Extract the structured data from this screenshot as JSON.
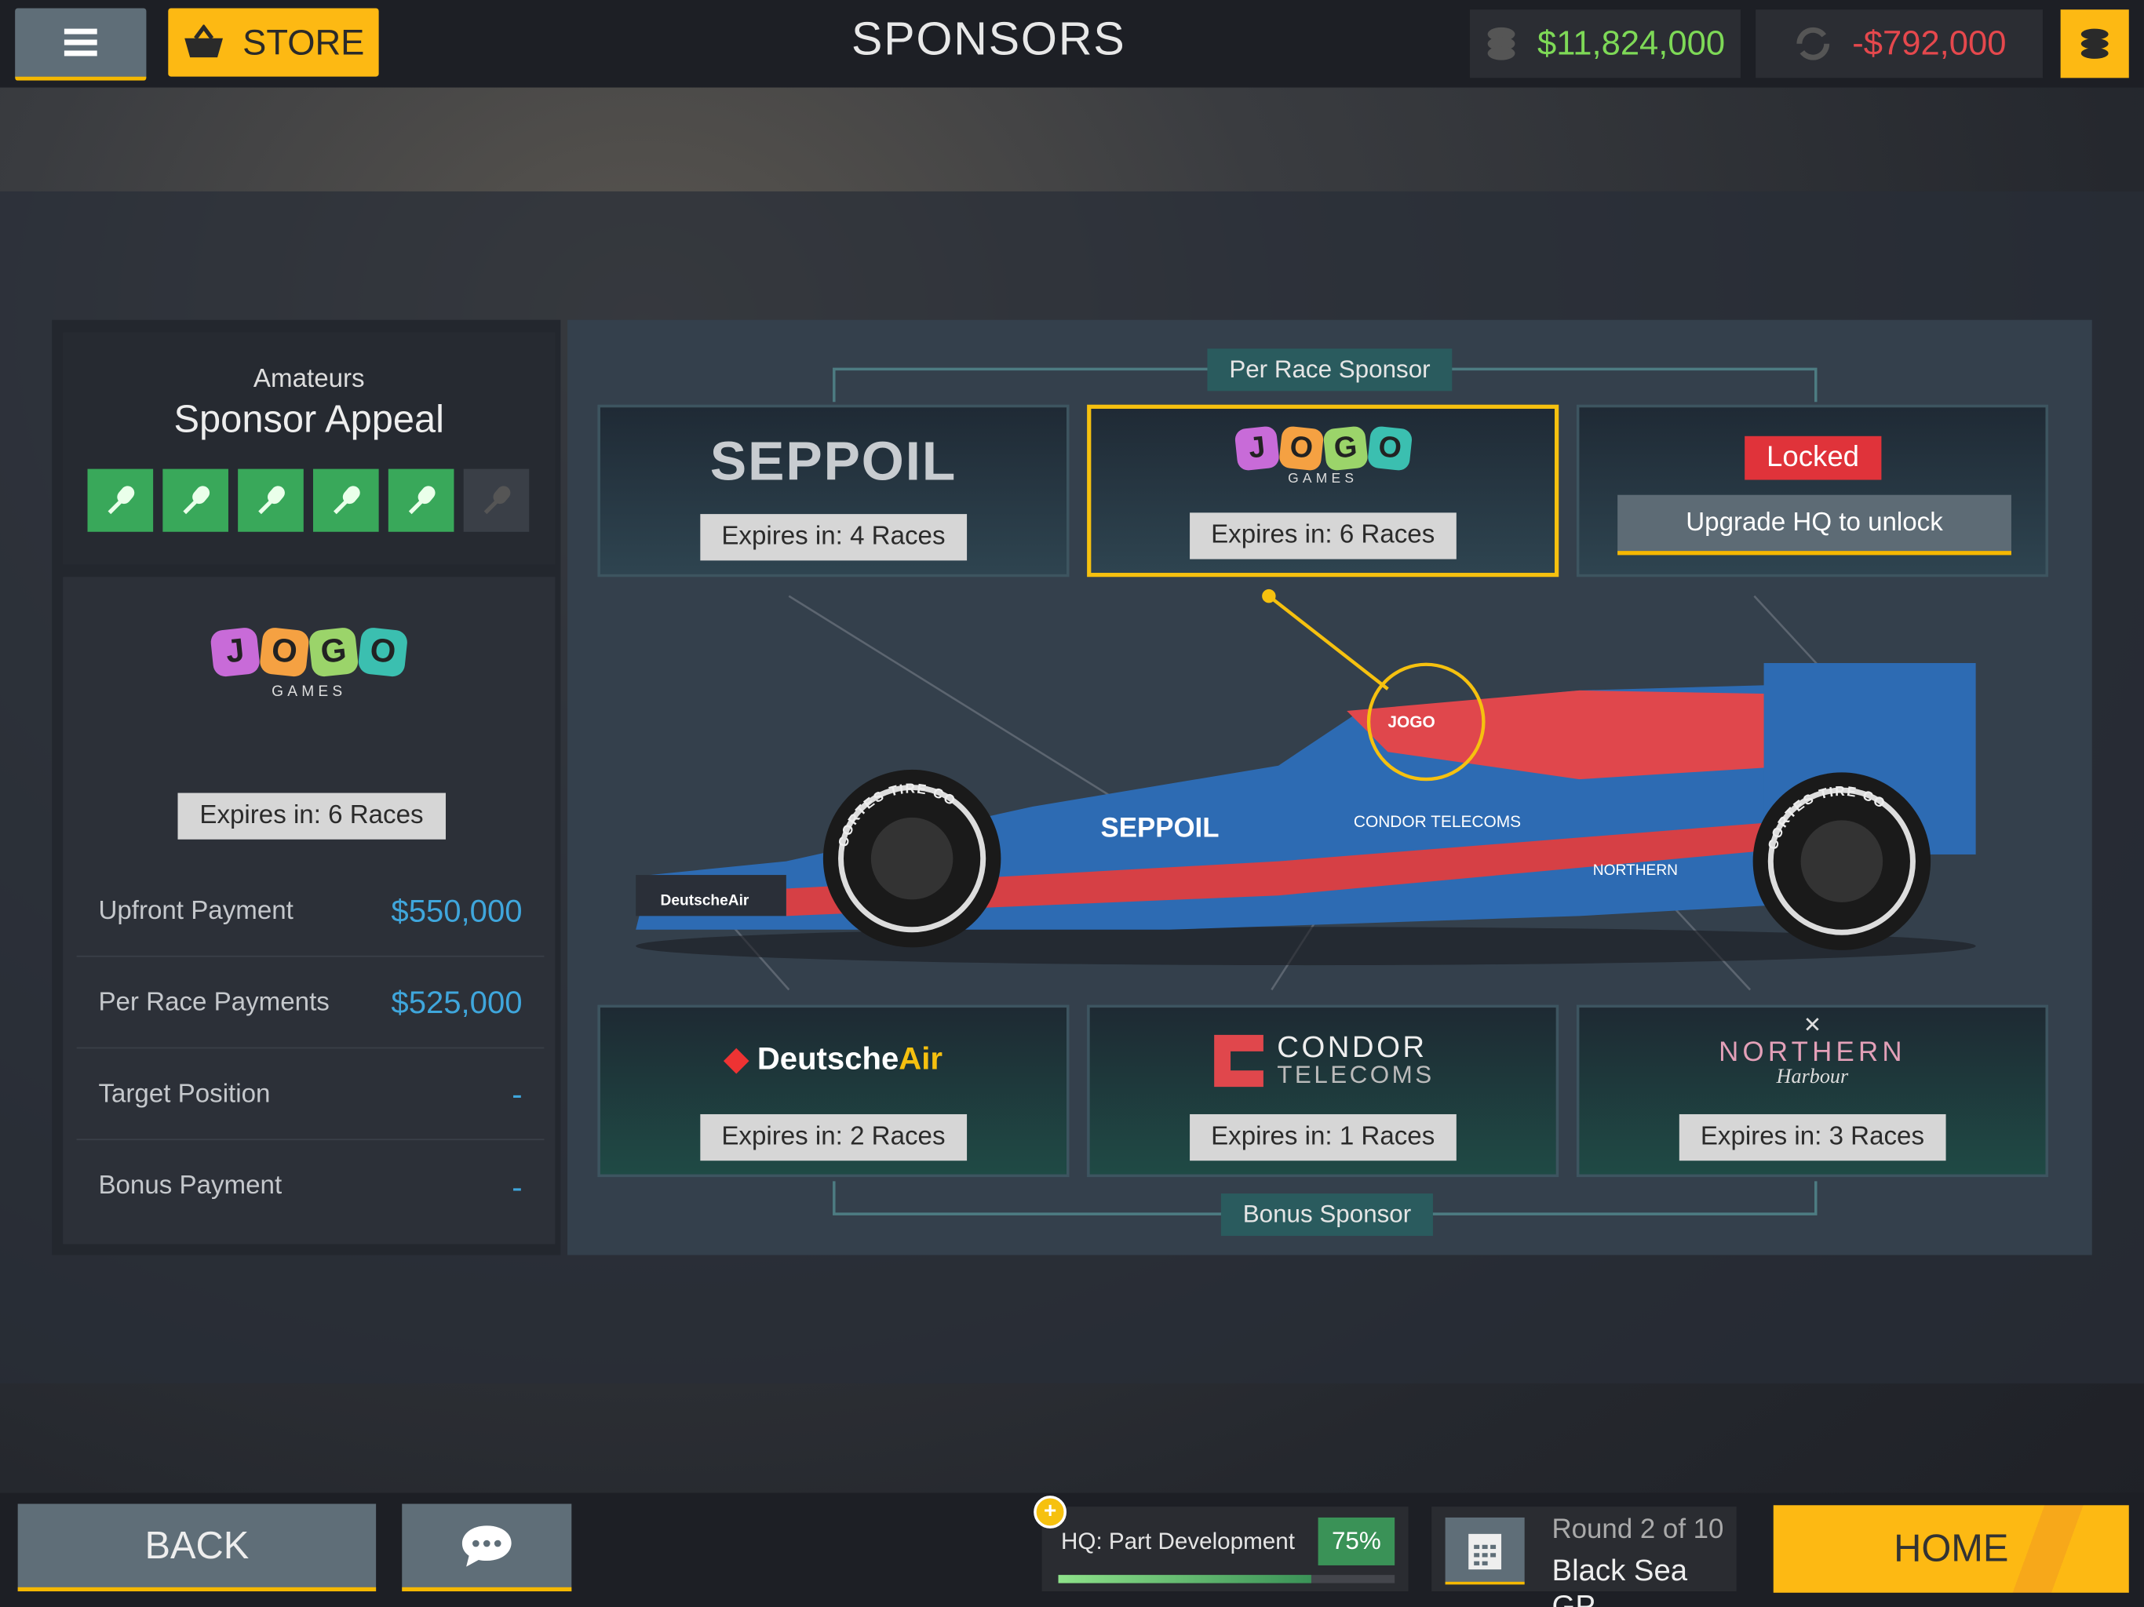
{
  "header": {
    "title": "SPONSORS",
    "store_label": "STORE",
    "balance": "$11,824,000",
    "balance_color": "#7ed957",
    "net_change": "-$792,000",
    "net_change_color": "#e5484d",
    "accent": "#fdb913"
  },
  "appeal": {
    "tier": "Amateurs",
    "title": "Sponsor Appeal",
    "level": 5,
    "max": 6
  },
  "selected": {
    "logo": "JOGO",
    "logo_sub": "GAMES",
    "expires": "Expires in: 6 Races",
    "rows": [
      {
        "label": "Upfront Payment",
        "value": "$550,000"
      },
      {
        "label": "Per Race Payments",
        "value": "$525,000"
      },
      {
        "label": "Target Position",
        "value": "-"
      },
      {
        "label": "Bonus Payment",
        "value": "-"
      }
    ]
  },
  "per_race": {
    "label": "Per Race Sponsor",
    "slots": [
      {
        "logo": "SEPPOIL",
        "expires": "Expires in: 4 Races"
      },
      {
        "logo": "JOGO",
        "logo_sub": "GAMES",
        "expires": "Expires in: 6 Races",
        "selected": true
      },
      {
        "locked": "Locked",
        "action": "Upgrade HQ to unlock"
      }
    ]
  },
  "bonus": {
    "label": "Bonus Sponsor",
    "slots": [
      {
        "logo": "DeutscheAir",
        "logo_a": "Deutsche",
        "logo_b": "Air",
        "expires": "Expires in: 2 Races"
      },
      {
        "logo": "CONDOR TELECOMS",
        "logo_a": "CONDOR",
        "logo_b": "TELECOMS",
        "expires": "Expires in: 1 Races"
      },
      {
        "logo": "NORTHERN Harbour",
        "logo_a": "NORTHERN",
        "logo_b": "Harbour",
        "expires": "Expires in: 3 Races"
      }
    ]
  },
  "car": {
    "livery": [
      "SEPPOIL",
      "CONDOR TELECOMS",
      "NORTHERN Harbour",
      "DeutscheAir",
      "JOGO GAMES",
      "CORTES TIRE CO"
    ]
  },
  "footer": {
    "back": "BACK",
    "hq_label": "HQ: Part Development",
    "hq_percent": "75%",
    "hq_progress": 0.75,
    "round": "Round 2 of 10",
    "race": "Black Sea GP",
    "home": "HOME"
  }
}
